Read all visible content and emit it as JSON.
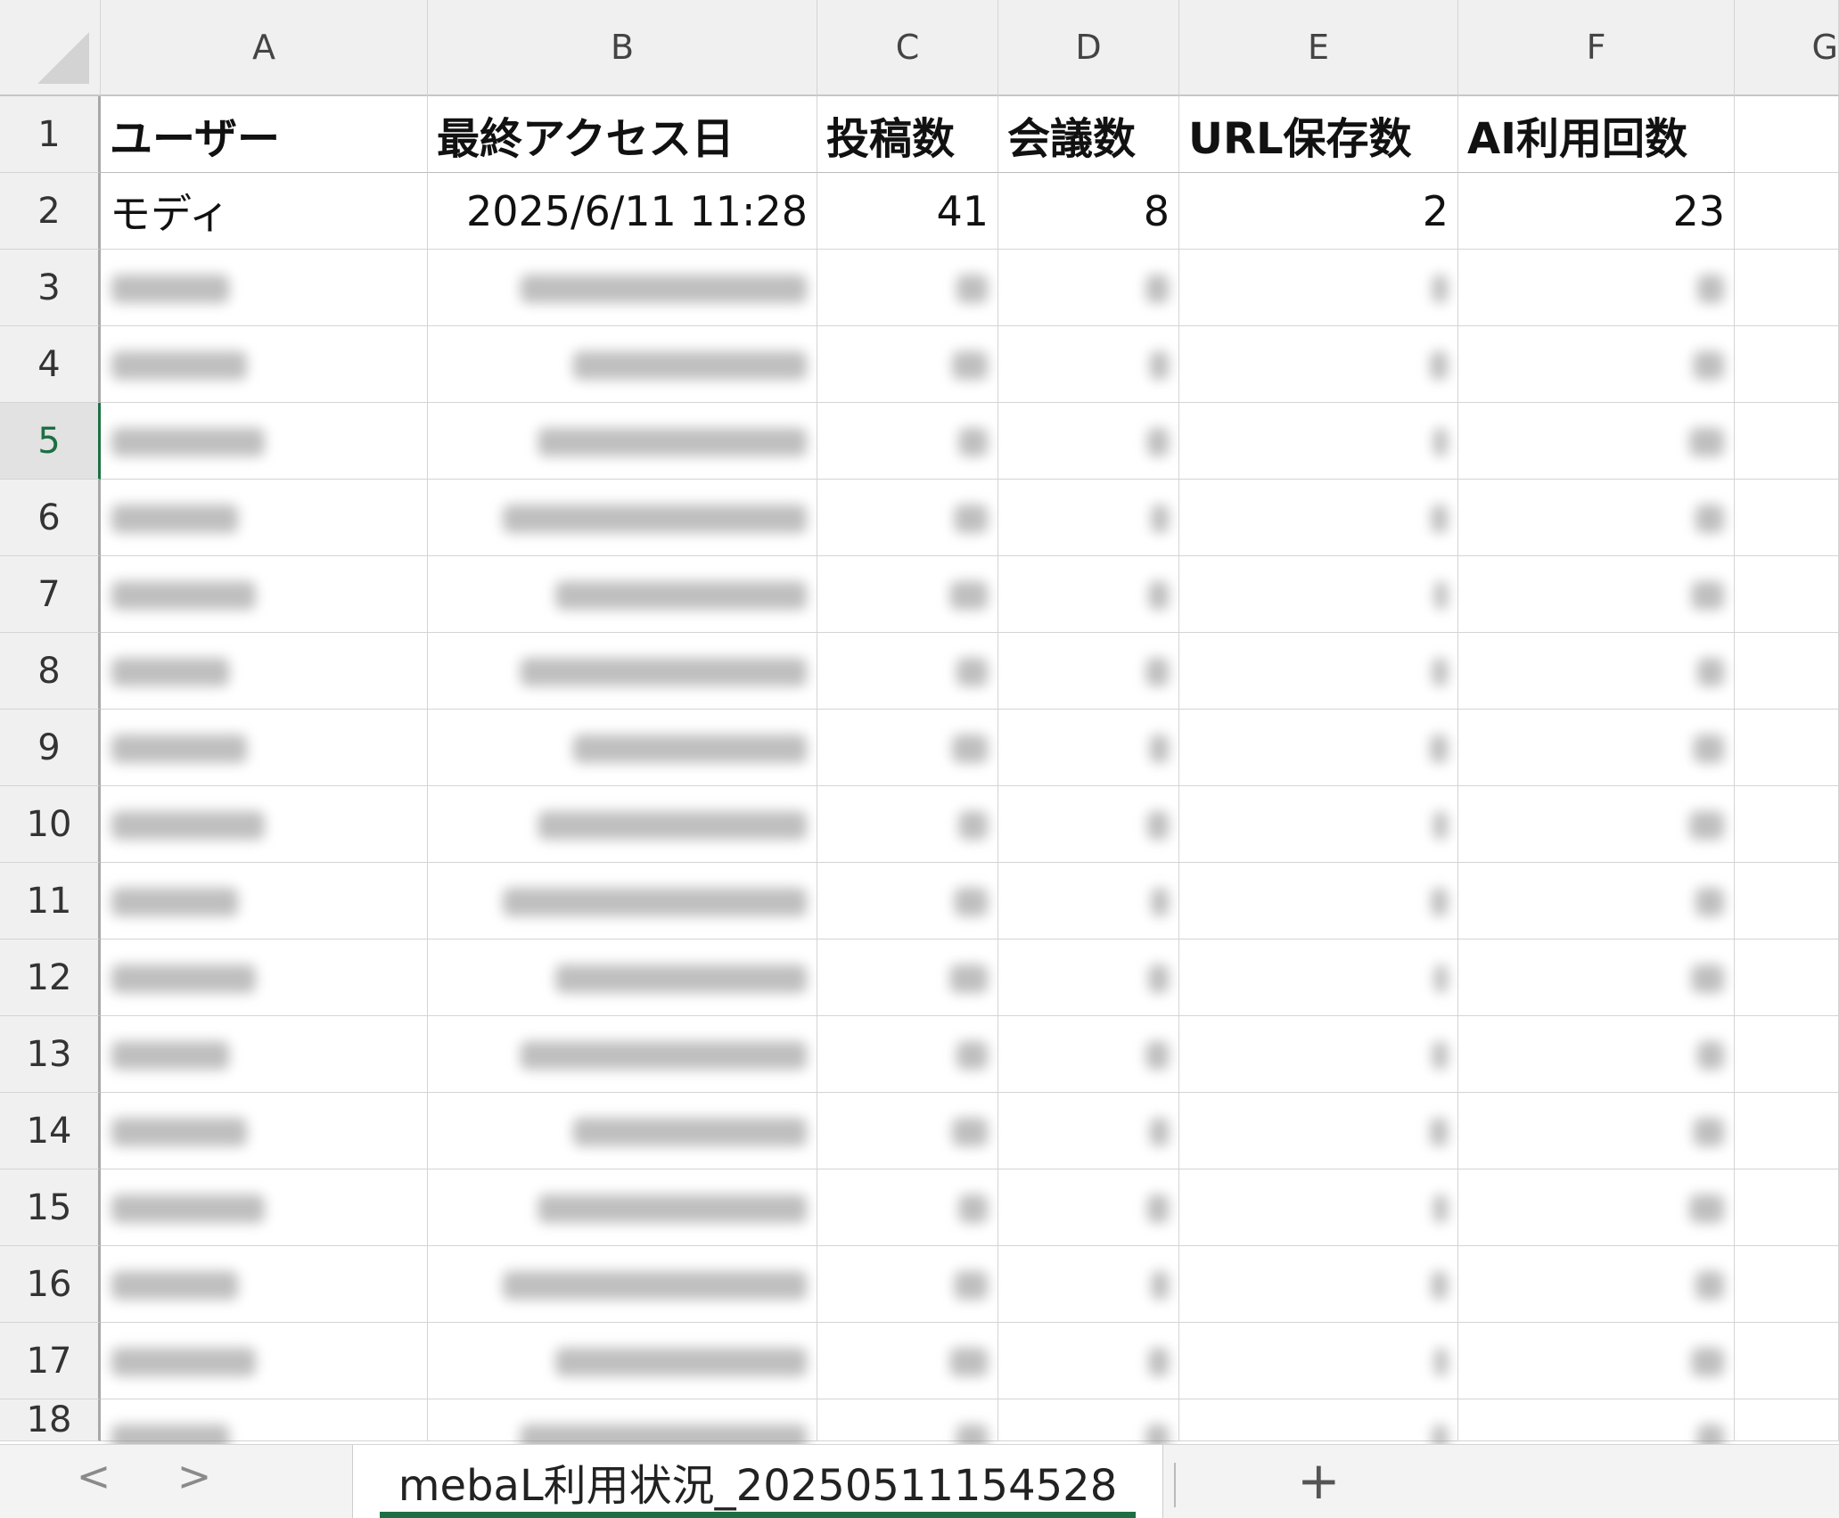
{
  "columns": [
    "A",
    "B",
    "C",
    "D",
    "E",
    "F",
    "G"
  ],
  "row_numbers": [
    "1",
    "2",
    "3",
    "4",
    "5",
    "6",
    "7",
    "8",
    "9",
    "10",
    "11",
    "12",
    "13",
    "14",
    "15",
    "16",
    "17",
    "18"
  ],
  "headers": [
    "ユーザー",
    "最終アクセス日",
    "投稿数",
    "会議数",
    "URL保存数",
    "AI利用回数"
  ],
  "visible_row": {
    "user": "モディ",
    "last_access": "2025/6/11 11:28",
    "posts": "41",
    "meetings": "8",
    "url_saves": "2",
    "ai_uses": "23"
  },
  "sheet_tab": "mebaL利用状況_20250511154528",
  "nav": {
    "prev": "<",
    "next": ">",
    "add": "+"
  },
  "colors": {
    "accent": "#1d6f42",
    "header_bg": "#f0f0f0",
    "grid_line": "#d4d4d4"
  }
}
